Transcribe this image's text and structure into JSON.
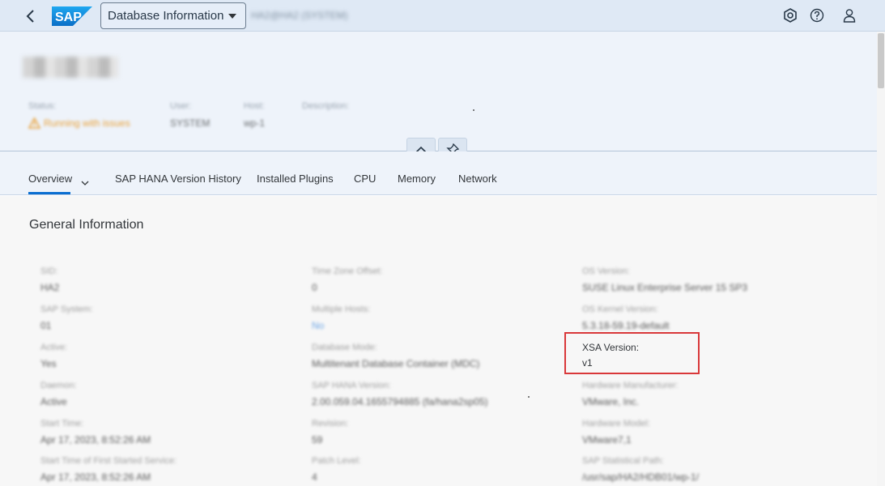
{
  "shell": {
    "app_title": "Database Information",
    "system_id": "HA2@HA2 (SYSTEM)",
    "icons": [
      "back-icon",
      "settings-icon",
      "help-icon",
      "user-icon"
    ]
  },
  "header": {
    "object_title": "HA2@HA2",
    "attributes": [
      {
        "label": "Status:",
        "value": "Running with issues"
      },
      {
        "label": "User:",
        "value": "SYSTEM"
      },
      {
        "label": "Host:",
        "value": "wp-1"
      },
      {
        "label": "Description:",
        "value": ""
      }
    ]
  },
  "tabs": [
    {
      "label": "Overview"
    },
    {
      "label": "SAP HANA Version History"
    },
    {
      "label": "Installed Plugins"
    },
    {
      "label": "CPU"
    },
    {
      "label": "Memory"
    },
    {
      "label": "Network"
    }
  ],
  "section": {
    "title": "General Information"
  },
  "fields": {
    "col1": [
      {
        "label": "SID:",
        "value": "HA2"
      },
      {
        "label": "SAP System:",
        "value": "01"
      },
      {
        "label": "Active:",
        "value": "Yes"
      },
      {
        "label": "Daemon:",
        "value": "Active"
      },
      {
        "label": "Start Time:",
        "value": "Apr 17, 2023, 8:52:26 AM"
      },
      {
        "label": "Start Time of First Started Service:",
        "value": "Apr 17, 2023, 8:52:26 AM"
      }
    ],
    "col2": [
      {
        "label": "Time Zone Offset:",
        "value": "0"
      },
      {
        "label": "Multiple Hosts:",
        "value": "No"
      },
      {
        "label": "Database Mode:",
        "value": "Multitenant Database Container (MDC)"
      },
      {
        "label": "SAP HANA Version:",
        "value": "2.00.059.04.1655794885 (fa/hana2sp05)"
      },
      {
        "label": "Revision:",
        "value": "59"
      },
      {
        "label": "Patch Level:",
        "value": "4"
      }
    ],
    "col3": [
      {
        "label": "OS Version:",
        "value": "SUSE Linux Enterprise Server 15 SP3"
      },
      {
        "label": "OS Kernel Version:",
        "value": "5.3.18-59.19-default"
      },
      {
        "label": "XSA Version:",
        "value": "v1"
      },
      {
        "label": "Hardware Manufacturer:",
        "value": "VMware, Inc."
      },
      {
        "label": "Hardware Model:",
        "value": "VMware7,1"
      },
      {
        "label": "SAP Statistical Path:",
        "value": "/usr/sap/HA2/HDB01/wp-1/"
      }
    ]
  },
  "colors": {
    "shell_bg": "#dfe9f5",
    "header_bg": "#eef3fa",
    "accent": "#0a6ed1",
    "warning": "#e9a23b",
    "highlight": "#d9383a"
  }
}
